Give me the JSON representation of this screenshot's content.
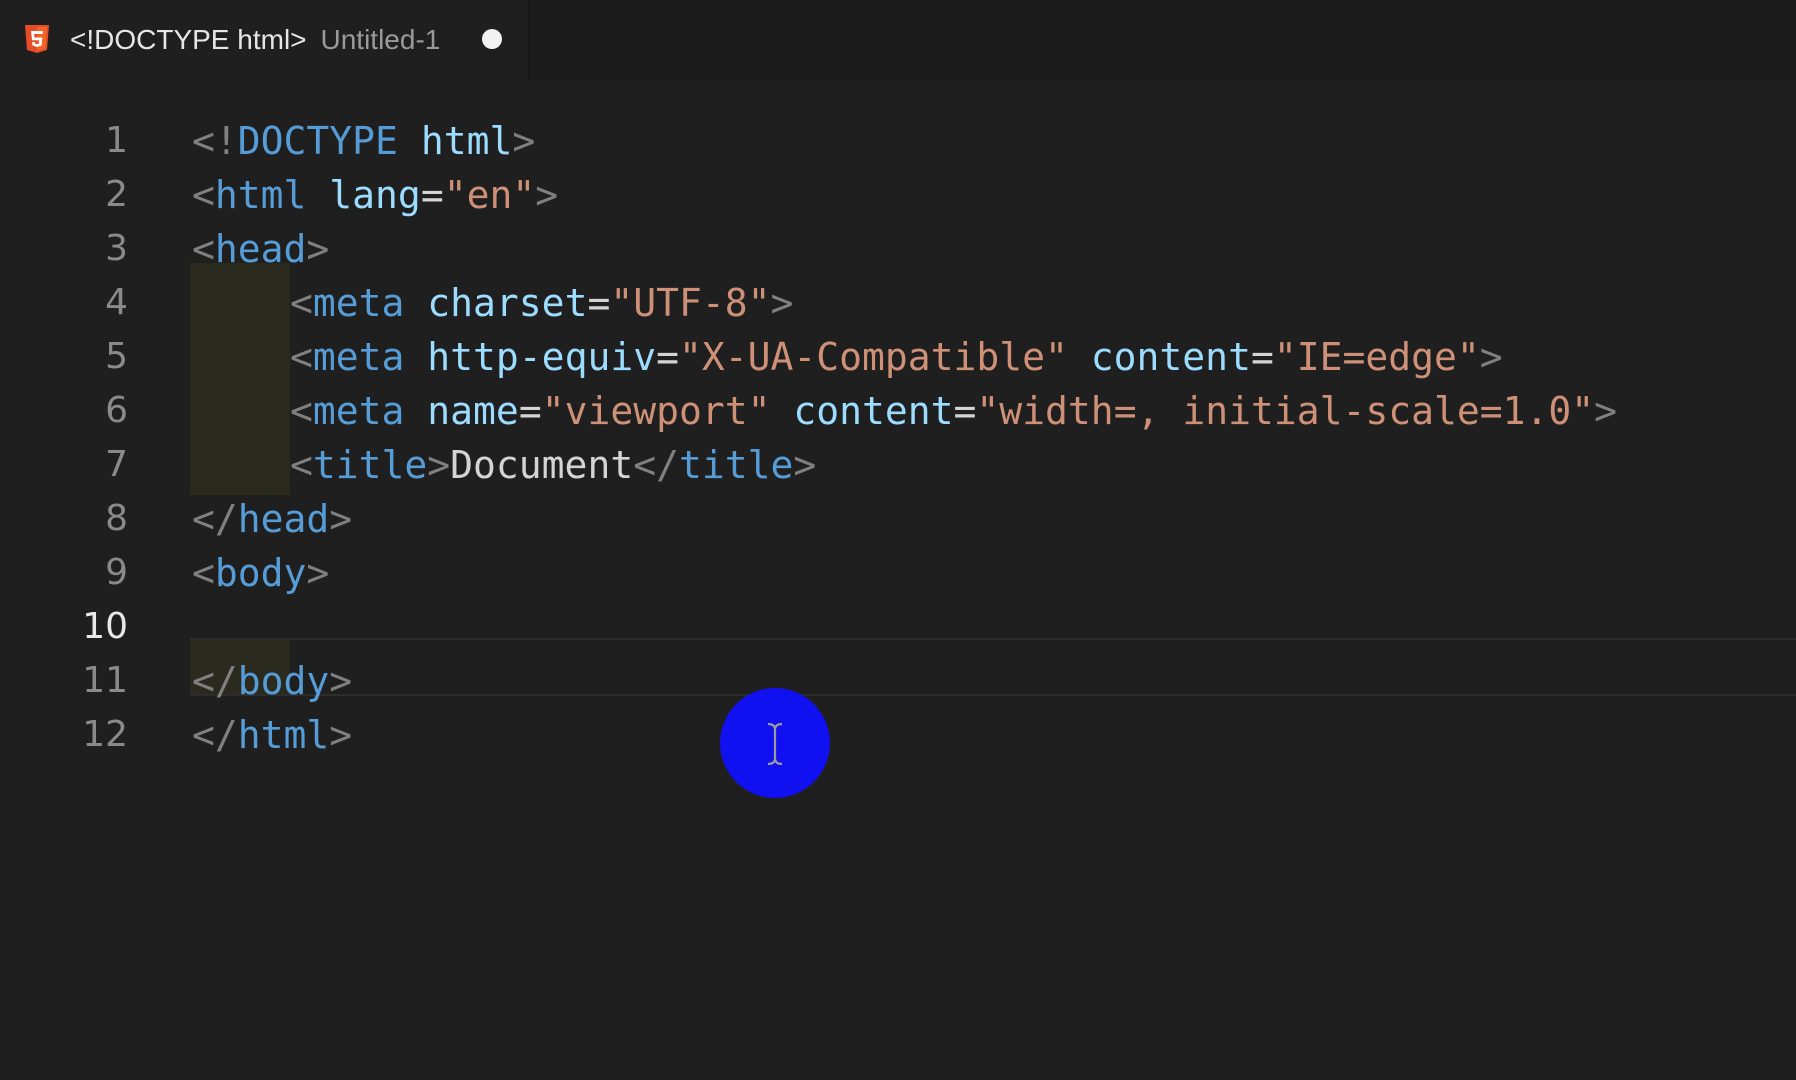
{
  "tab": {
    "title": "<!DOCTYPE html>",
    "description": "Untitled-1",
    "icon": "html5-icon",
    "modified_indicator": "unsaved-dot-icon"
  },
  "colors": {
    "tag": "#569cd6",
    "attribute": "#9cdcfe",
    "string": "#ce9178",
    "punctuation": "#808080",
    "text": "#d4d4d4",
    "cursor_highlight": "#1010f0"
  },
  "editor": {
    "active_line": 10,
    "lines": [
      {
        "number": "1",
        "tokens": [
          {
            "t": "punct",
            "v": "<!"
          },
          {
            "t": "tag",
            "v": "DOCTYPE"
          },
          {
            "t": "text",
            "v": " "
          },
          {
            "t": "attr",
            "v": "html"
          },
          {
            "t": "punct",
            "v": ">"
          }
        ]
      },
      {
        "number": "2",
        "tokens": [
          {
            "t": "punct",
            "v": "<"
          },
          {
            "t": "tag",
            "v": "html"
          },
          {
            "t": "text",
            "v": " "
          },
          {
            "t": "attr",
            "v": "lang"
          },
          {
            "t": "text",
            "v": "="
          },
          {
            "t": "str",
            "v": "\"en\""
          },
          {
            "t": "punct",
            "v": ">"
          }
        ]
      },
      {
        "number": "3",
        "tokens": [
          {
            "t": "punct",
            "v": "<"
          },
          {
            "t": "tag",
            "v": "head"
          },
          {
            "t": "punct",
            "v": ">"
          }
        ]
      },
      {
        "number": "4",
        "indent": true,
        "tokens": [
          {
            "t": "punct",
            "v": "<"
          },
          {
            "t": "tag",
            "v": "meta"
          },
          {
            "t": "text",
            "v": " "
          },
          {
            "t": "attr",
            "v": "charset"
          },
          {
            "t": "text",
            "v": "="
          },
          {
            "t": "str",
            "v": "\"UTF-8\""
          },
          {
            "t": "punct",
            "v": ">"
          }
        ]
      },
      {
        "number": "5",
        "indent": true,
        "tokens": [
          {
            "t": "punct",
            "v": "<"
          },
          {
            "t": "tag",
            "v": "meta"
          },
          {
            "t": "text",
            "v": " "
          },
          {
            "t": "attr",
            "v": "http-equiv"
          },
          {
            "t": "text",
            "v": "="
          },
          {
            "t": "str",
            "v": "\"X-UA-Compatible\""
          },
          {
            "t": "text",
            "v": " "
          },
          {
            "t": "attr",
            "v": "content"
          },
          {
            "t": "text",
            "v": "="
          },
          {
            "t": "str",
            "v": "\"IE=edge\""
          },
          {
            "t": "punct",
            "v": ">"
          }
        ]
      },
      {
        "number": "6",
        "indent": true,
        "tokens": [
          {
            "t": "punct",
            "v": "<"
          },
          {
            "t": "tag",
            "v": "meta"
          },
          {
            "t": "text",
            "v": " "
          },
          {
            "t": "attr",
            "v": "name"
          },
          {
            "t": "text",
            "v": "="
          },
          {
            "t": "str",
            "v": "\"viewport\""
          },
          {
            "t": "text",
            "v": " "
          },
          {
            "t": "attr",
            "v": "content"
          },
          {
            "t": "text",
            "v": "="
          },
          {
            "t": "str",
            "v": "\"width=, initial-scale=1.0\""
          },
          {
            "t": "punct",
            "v": ">"
          }
        ]
      },
      {
        "number": "7",
        "indent": true,
        "tokens": [
          {
            "t": "punct",
            "v": "<"
          },
          {
            "t": "tag",
            "v": "title"
          },
          {
            "t": "punct",
            "v": ">"
          },
          {
            "t": "text",
            "v": "Document"
          },
          {
            "t": "punct",
            "v": "</"
          },
          {
            "t": "tag",
            "v": "title"
          },
          {
            "t": "punct",
            "v": ">"
          }
        ]
      },
      {
        "number": "8",
        "tokens": [
          {
            "t": "punct",
            "v": "</"
          },
          {
            "t": "tag",
            "v": "head"
          },
          {
            "t": "punct",
            "v": ">"
          }
        ]
      },
      {
        "number": "9",
        "tokens": [
          {
            "t": "punct",
            "v": "<"
          },
          {
            "t": "tag",
            "v": "body"
          },
          {
            "t": "punct",
            "v": ">"
          }
        ]
      },
      {
        "number": "10",
        "tokens": []
      },
      {
        "number": "11",
        "tokens": [
          {
            "t": "punct",
            "v": "</"
          },
          {
            "t": "tag",
            "v": "body"
          },
          {
            "t": "punct",
            "v": ">"
          }
        ]
      },
      {
        "number": "12",
        "tokens": [
          {
            "t": "punct",
            "v": "</"
          },
          {
            "t": "tag",
            "v": "html"
          },
          {
            "t": "punct",
            "v": ">"
          }
        ]
      }
    ]
  },
  "pointer": {
    "icon": "text-cursor-icon"
  }
}
